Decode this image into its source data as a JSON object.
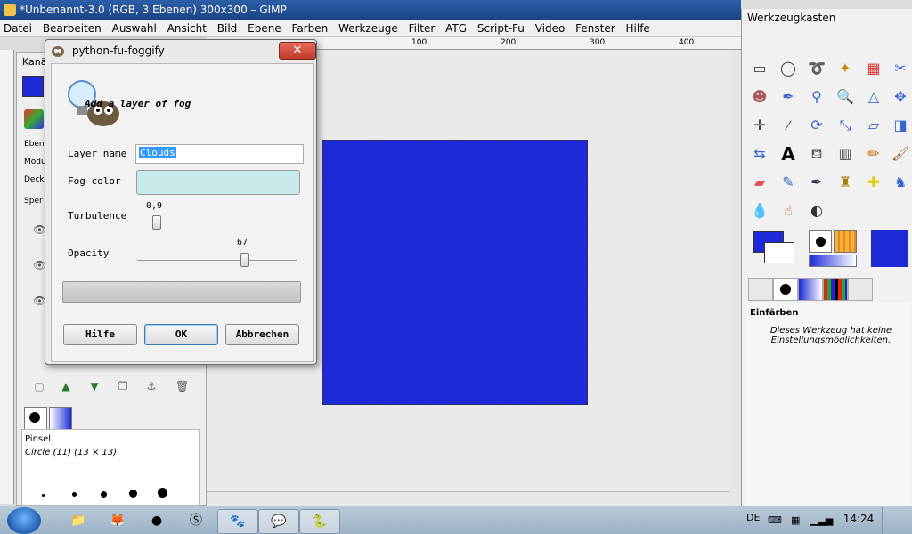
{
  "window": {
    "title": "*Unbenannt-3.0 (RGB, 3 Ebenen) 300x300 – GIMP"
  },
  "menubar": [
    "Datei",
    "Bearbeiten",
    "Auswahl",
    "Ansicht",
    "Bild",
    "Ebene",
    "Farben",
    "Werkzeuge",
    "Filter",
    "ATG",
    "Script-Fu",
    "Video",
    "Fenster",
    "Hilfe"
  ],
  "ruler": {
    "ticks": [
      "100",
      "200",
      "300",
      "400"
    ]
  },
  "layers_dock": {
    "tab_label": "Kanä",
    "ebenen_label": "Ebene",
    "modus_label": "Modus",
    "deckkraft_label": "Deck",
    "sperre_label": "Sper"
  },
  "brushes": {
    "title": "Pinsel",
    "selected": "Circle (11) (13 × 13)"
  },
  "toolbox": {
    "title": "Werkzeugkasten",
    "options_title": "Einfärben",
    "options_message": "Dieses Werkzeug hat keine Einstellungsmöglichkeiten.",
    "colors": {
      "foreground": "#1e2ad8",
      "background": "#ffffff"
    }
  },
  "dialog": {
    "title": "python-fu-foggify",
    "close_label": "✕",
    "headline": "Add a layer of fog",
    "layer_name_label": "Layer name",
    "layer_name_value": "Clouds",
    "fog_color_label": "Fog color",
    "fog_color": "#c9eaea",
    "turbulence_label": "Turbulence",
    "turbulence_value": "0,9",
    "turbulence_fraction": 0.12,
    "opacity_label": "Opacity",
    "opacity_value": "67",
    "opacity_fraction": 0.67,
    "buttons": {
      "help": "Hilfe",
      "ok": "OK",
      "cancel": "Abbrechen"
    }
  },
  "taskbar": {
    "language": "DE",
    "clock": "14:24"
  }
}
